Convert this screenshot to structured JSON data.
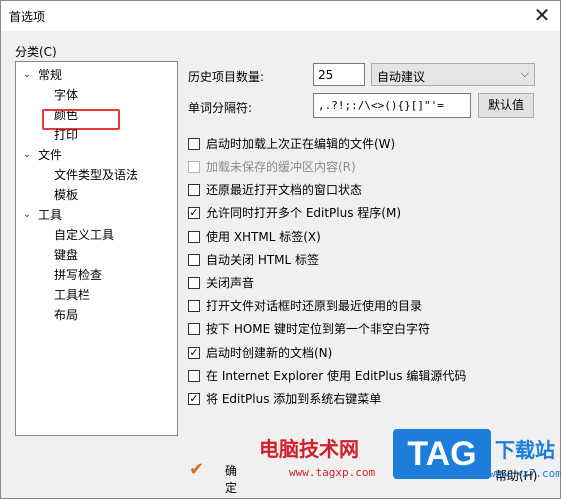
{
  "window": {
    "title": "首选项",
    "close_glyph": "✕"
  },
  "category": {
    "label": "分类(C)",
    "tree": [
      {
        "label": "常规",
        "level": 0,
        "expanded": true
      },
      {
        "label": "字体",
        "level": 1
      },
      {
        "label": "颜色",
        "level": 1,
        "highlighted": true
      },
      {
        "label": "打印",
        "level": 1
      },
      {
        "label": "文件",
        "level": 0,
        "expanded": true
      },
      {
        "label": "文件类型及语法",
        "level": 1
      },
      {
        "label": "模板",
        "level": 1
      },
      {
        "label": "工具",
        "level": 0,
        "expanded": true
      },
      {
        "label": "自定义工具",
        "level": 1
      },
      {
        "label": "键盘",
        "level": 1
      },
      {
        "label": "拼写检查",
        "level": 1
      },
      {
        "label": "工具栏",
        "level": 1
      },
      {
        "label": "布局",
        "level": 1
      }
    ]
  },
  "history": {
    "label": "历史项目数量:",
    "value": "25",
    "select_value": "自动建议"
  },
  "delimiter": {
    "label": "单词分隔符:",
    "value": ",.?!;:/\\<>(){}[]\"'=",
    "default_button": "默认值"
  },
  "options": [
    {
      "label": "启动时加载上次正在编辑的文件(W)",
      "checked": false,
      "disabled": false
    },
    {
      "label": "加载未保存的缓冲区内容(R)",
      "checked": false,
      "disabled": true
    },
    {
      "label": "还原最近打开文档的窗口状态",
      "checked": false,
      "disabled": false
    },
    {
      "label": "允许同时打开多个 EditPlus 程序(M)",
      "checked": true,
      "disabled": false
    },
    {
      "label": "使用 XHTML 标签(X)",
      "checked": false,
      "disabled": false
    },
    {
      "label": "自动关闭 HTML 标签",
      "checked": false,
      "disabled": false
    },
    {
      "label": "关闭声音",
      "checked": false,
      "disabled": false
    },
    {
      "label": "打开文件对话框时还原到最近使用的目录",
      "checked": false,
      "disabled": false
    },
    {
      "label": "按下 HOME 键时定位到第一个非空白字符",
      "checked": false,
      "disabled": false
    },
    {
      "label": "启动时创建新的文档(N)",
      "checked": true,
      "disabled": false
    },
    {
      "label": "在 Internet Explorer 使用 EditPlus 编辑源代码",
      "checked": false,
      "disabled": false
    },
    {
      "label": "将 EditPlus 添加到系统右键菜单",
      "checked": true,
      "disabled": false
    }
  ],
  "buttons": {
    "ok": "确定",
    "help": "帮助(H)"
  },
  "watermark": {
    "site_name": "电脑技术网",
    "site_url": "www.tagxp.com",
    "logo_text": "TAG",
    "brand": "下载站",
    "brand_url": "www.xz7.com"
  },
  "colors": {
    "highlight_box": "#e03a3a",
    "watermark_red": "#d0202a",
    "watermark_blue": "#1d7ddb"
  }
}
